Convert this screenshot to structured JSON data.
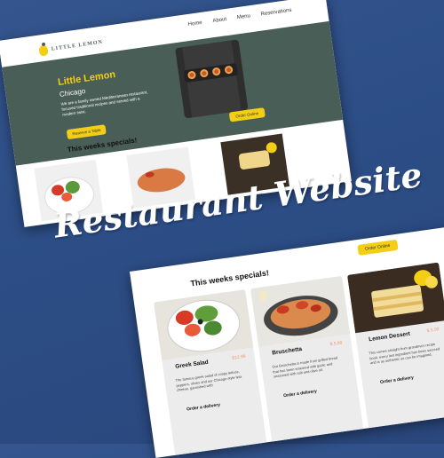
{
  "header": {
    "logo_text": "LITTLE LEMON",
    "nav": [
      "Home",
      "About",
      "Menu",
      "Reservations"
    ]
  },
  "hero": {
    "title": "Little Lemon",
    "city": "Chicago",
    "description": "We are a family owned Mediterranean restaurant, focused traditional recipes and served with a modern twist.",
    "reserve_label": "Reserve a Table"
  },
  "title": "Restaurant Website",
  "specials": {
    "heading": "This weeks specials!",
    "order_online_label": "Order Online",
    "items": [
      {
        "name": "Greek Salad",
        "price": "$12.99",
        "description": "The famous greek salad of crispy lettuce, peppers, olives and our Chicago style feta cheese, garnished with",
        "order_label": "Order a delivery"
      },
      {
        "name": "Bruschetta",
        "price": "$ 5.99",
        "description": "Our Bruschetta is made from grilled bread that has been smeared with garlic and seasoned with salt and olive oil.",
        "order_label": "Order a delivery"
      },
      {
        "name": "Lemon Dessert",
        "price": "$ 5.00",
        "description": "This comes straight from grandma's recipe book, every last ingredient has been sourced and is as authentic as can be imagined.",
        "order_label": "Order a delivery"
      }
    ]
  },
  "colors": {
    "background": "#2f5088",
    "hero_green": "#495e57",
    "accent_yellow": "#f4ce14",
    "price_orange": "#ee9972"
  }
}
